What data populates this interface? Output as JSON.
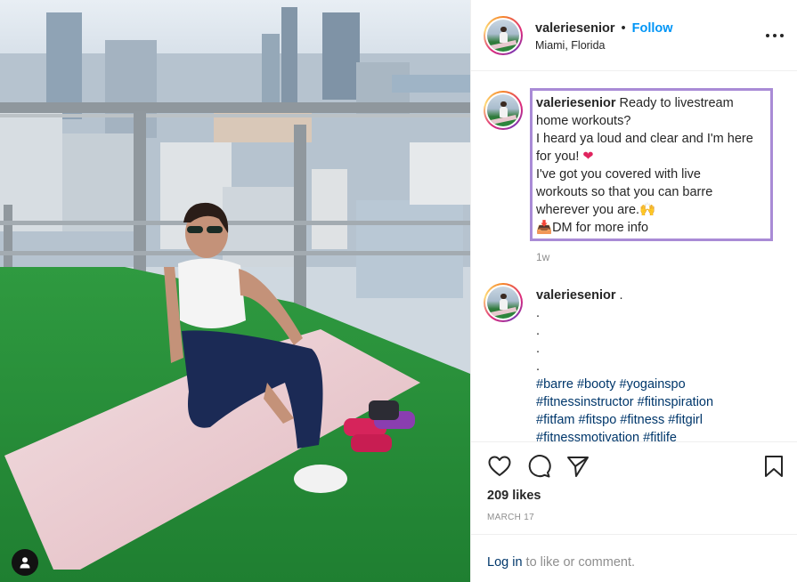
{
  "post": {
    "username": "valeriesenior",
    "separator": "•",
    "follow_label": "Follow",
    "location": "Miami, Florida",
    "more_icon": "more-options-icon"
  },
  "photo": {
    "description_icon": "user-tag-icon",
    "colors": {
      "sky": "#dfe6ee",
      "turf": "#2e9a3f",
      "mat": "#e7c6cc",
      "leggings": "#1b2a55"
    }
  },
  "caption": {
    "username": "valeriesenior",
    "lines": [
      "Ready to livestream",
      "home workouts?",
      "I heard ya loud and clear and I'm here",
      "for you! ",
      "I've got you covered with live",
      "workouts so that you can barre",
      "wherever you are.",
      "DM for more info"
    ],
    "heart": "❤",
    "hands": "🙌",
    "inbox": "📥",
    "time": "1w"
  },
  "comment2": {
    "username": "valeriesenior",
    "first": " .",
    "dots": [
      ".",
      ".",
      ".",
      "."
    ],
    "hashtags_1": "#barre #booty #yogainspo",
    "hashtags_2": "#fitnessinstructor #fitinspiration",
    "hashtags_3": "#fitfam #fitspo #fitness #fitgirl",
    "hashtags_4": "#fitnessmotivation #fitlife"
  },
  "actions": {
    "likes": "209 likes",
    "date": "MARCH 17"
  },
  "login": {
    "link": "Log in",
    "rest": " to like or comment."
  }
}
